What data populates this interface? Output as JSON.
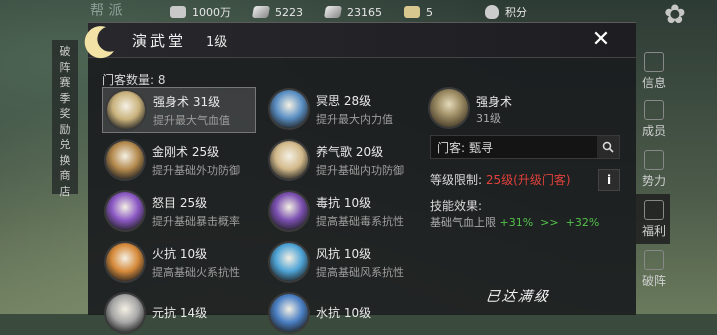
{
  "resources": [
    {
      "icon": "coin-icon",
      "value": "1000万"
    },
    {
      "icon": "silver-ingot-icon",
      "value": "5223"
    },
    {
      "icon": "jade-token-icon",
      "value": "23165"
    },
    {
      "icon": "scroll-icon",
      "value": "5"
    },
    {
      "icon": "shield-icon",
      "value": "积分"
    }
  ],
  "left_strip": [
    "破",
    "阵",
    "赛",
    "季",
    "奖",
    "励",
    "兑",
    "换",
    "商",
    "店"
  ],
  "top_deco": "帮 派",
  "panel": {
    "title": "演武堂",
    "level": "1级",
    "member_count": "门客数量: 8"
  },
  "skills": [
    {
      "name": "强身术 31级",
      "desc": "提升最大气血值",
      "color": "#c9b27c"
    },
    {
      "name": "冥思 28级",
      "desc": "提升最大内力值",
      "color": "#5a8fc4"
    },
    {
      "name": "金刚术 25级",
      "desc": "提升基础外功防御",
      "color": "#b48a4e"
    },
    {
      "name": "养气歌 20级",
      "desc": "提升基础内功防御",
      "color": "#d2b98a"
    },
    {
      "name": "怒目 25级",
      "desc": "提升基础暴击概率",
      "color": "#8b58c4"
    },
    {
      "name": "毒抗 10级",
      "desc": "提高基础毒系抗性",
      "color": "#7a4fb0"
    },
    {
      "name": "火抗 10级",
      "desc": "提高基础火系抗性",
      "color": "#d68a3a"
    },
    {
      "name": "风抗 10级",
      "desc": "提高基础风系抗性",
      "color": "#4ea3d6"
    },
    {
      "name": "元抗 14级",
      "desc": "",
      "color": "#a7a7a7"
    },
    {
      "name": "水抗 10级",
      "desc": "",
      "color": "#4a7fc4"
    }
  ],
  "detail": {
    "name": "强身术",
    "level": "31级",
    "member_label": "门客:",
    "member_value": "甄寻",
    "limit_label": "等级限制:",
    "limit_value": "25级(升级门客)",
    "info": "i",
    "effect_title": "技能效果:",
    "effect_base": "基础气血上限",
    "effect_now": "+31%",
    "effect_arrow": ">>",
    "effect_next": "+32%",
    "maxed": "已达满级"
  },
  "sidenav": [
    {
      "label": "信息"
    },
    {
      "label": "成员"
    },
    {
      "label": "势力"
    },
    {
      "label": "福利"
    },
    {
      "label": "破阵"
    }
  ],
  "close_symbol": "✕"
}
